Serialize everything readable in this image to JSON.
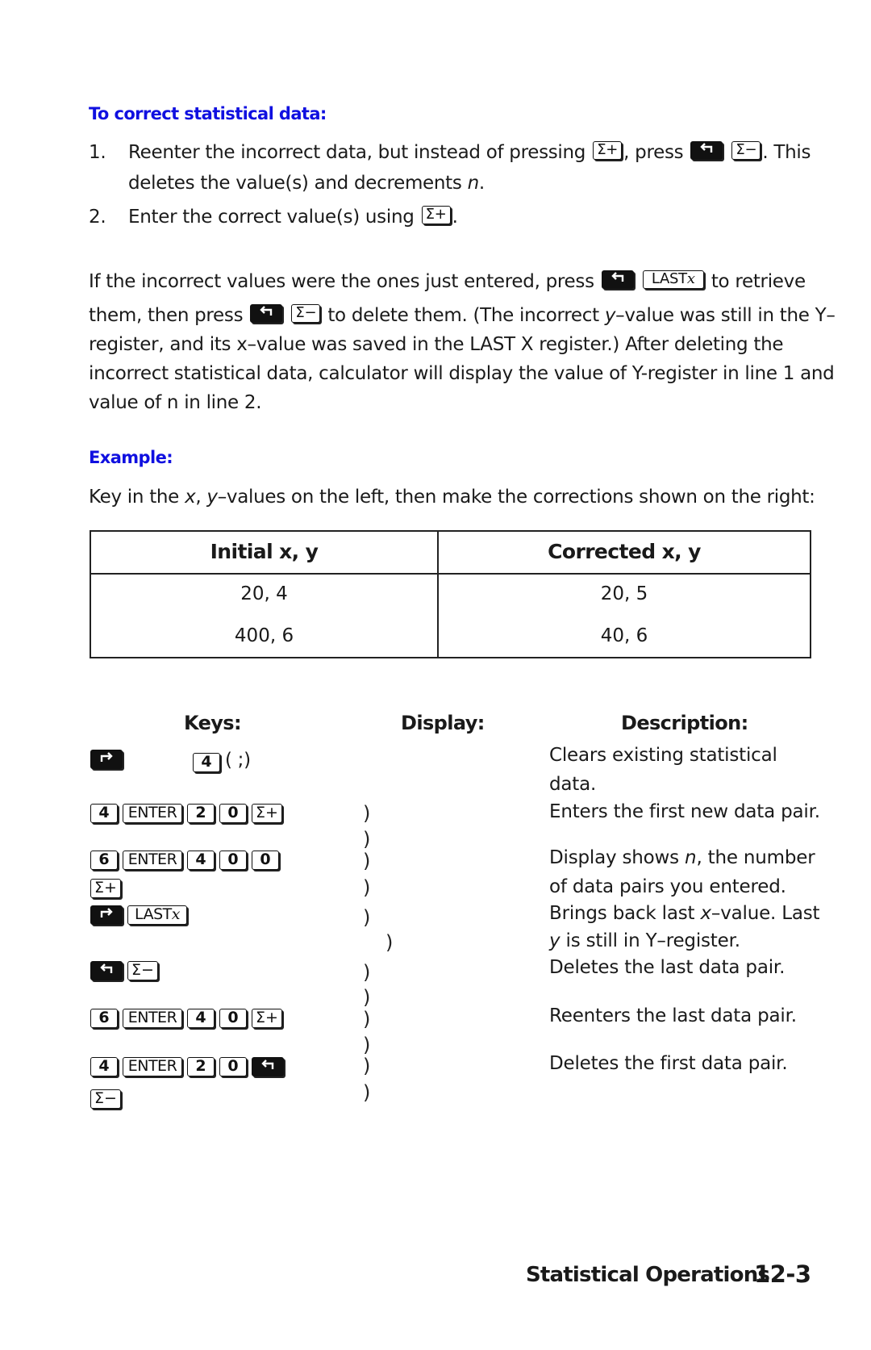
{
  "section": {
    "heading": "To correct statistical data:",
    "steps": [
      {
        "number": "1.",
        "text_before": "Reenter the incorrect data, but instead of pressing",
        "key1": "Σ+",
        "text_mid": ", press",
        "key2_icon": "left-shift-arrow",
        "key3": "Σ−",
        "text_after": ". This",
        "line2_before": "deletes the value(s) and decrements",
        "line2_var": "n",
        "line2_after": "."
      },
      {
        "number": "2.",
        "text_before": "Enter the correct value(s) using",
        "key1": "Σ+",
        "text_after": "."
      }
    ]
  },
  "paragraph": {
    "line1_before": "If the incorrect values were the ones just entered, press",
    "line1_key_shift": "left-shift-arrow",
    "line1_key": "LAST",
    "line1_key_var": "x",
    "line1_after": "to retrieve",
    "line2_before": "them, then press",
    "line2_key_shift": "left-shift-arrow",
    "line2_key": "Σ−",
    "line2_after_a": "to delete them. (The incorrect",
    "line2_var": "y",
    "line2_after_b": "–value was still in the Y–",
    "line3": "register, and its x–value was saved in the LAST X register.) After deleting the",
    "line4": "incorrect statistical data, calculator will display the value of Y-register in line 1 and",
    "line5": "value of n in line 2."
  },
  "example": {
    "heading": "Example:",
    "intro_before": "Key in the",
    "intro_var1": "x",
    "intro_mid": ",",
    "intro_var2": "y",
    "intro_after": "–values on the left, then make the corrections shown on the right:"
  },
  "table": {
    "headers": [
      "Initial x, y",
      "Corrected x, y"
    ],
    "rows": [
      [
        "20, 4",
        "20, 5"
      ],
      [
        "400, 6",
        "40, 6"
      ]
    ]
  },
  "keys_table": {
    "headers": {
      "keys": "Keys:",
      "display": "Display:",
      "description": "Description:"
    },
    "rows": [
      {
        "keys": [
          "right-shift-arrow",
          "4"
        ],
        "keys_suffix": "(   ;)",
        "display": "",
        "description_lines": [
          "Clears existing statistical",
          "data."
        ]
      },
      {
        "keys": [
          "4",
          "ENTER",
          "2",
          "0",
          "Σ+"
        ],
        "display": ")",
        "description_lines": [
          "Enters the first new data pair."
        ]
      },
      {
        "keys": [],
        "display": ")",
        "description_lines": []
      },
      {
        "keys": [
          "6",
          "ENTER",
          "4",
          "0",
          "0"
        ],
        "display": ")",
        "description_lines": [
          "Display shows n, the number"
        ]
      },
      {
        "keys": [
          "Σ+"
        ],
        "display": ")",
        "description_lines": [
          "of data pairs you entered."
        ]
      },
      {
        "keys": [
          "right-shift-arrow",
          "LASTx"
        ],
        "display": ")",
        "description_lines": [
          "Brings back last x–value. Last"
        ]
      },
      {
        "keys": [],
        "display": ")",
        "description_lines": [
          "y is still in Y–register."
        ]
      },
      {
        "keys": [
          "left-shift-arrow",
          "Σ−"
        ],
        "display": ")",
        "description_lines": [
          "Deletes the last data pair."
        ]
      },
      {
        "keys": [],
        "display": ")",
        "description_lines": []
      },
      {
        "keys": [
          "6",
          "ENTER",
          "4",
          "0",
          "Σ+"
        ],
        "display": ")",
        "description_lines": [
          "Reenters the last data pair."
        ]
      },
      {
        "keys": [],
        "display": ")",
        "description_lines": []
      },
      {
        "keys": [
          "4",
          "ENTER",
          "2",
          "0",
          "left-shift-arrow"
        ],
        "display": ")",
        "description_lines": [
          "Deletes the first data pair."
        ]
      },
      {
        "keys": [
          "Σ−"
        ],
        "display": ")",
        "description_lines": []
      }
    ],
    "desc_texts": {
      "clears_1": "Clears existing statistical",
      "clears_2": "data.",
      "enters_first": "Enters the first new data pair.",
      "display_shows_a": "Display shows",
      "display_shows_var": "n",
      "display_shows_b": ", the number",
      "of_pairs": "of data pairs you entered.",
      "brings_back_a": "Brings back last",
      "brings_back_var": "x",
      "brings_back_b": "–value. Last",
      "y_still_var": "y",
      "y_still_b": " is still in Y–register.",
      "deletes_last": "Deletes the last data pair.",
      "reenters_last": "Reenters the last data pair.",
      "deletes_first": "Deletes the first data pair."
    },
    "key_labels": {
      "four": "4",
      "two": "2",
      "zero": "0",
      "six": "6",
      "enter": "ENTER",
      "sigma_plus": "Σ+",
      "sigma_minus": "Σ−",
      "last": "LAST",
      "last_var": "x",
      "clear_suffix": "(   ;)",
      "paren": ")"
    }
  },
  "footer": {
    "chapter": "Statistical Operations",
    "page": "12-3"
  },
  "colors": {
    "heading_blue": "#1010e0",
    "text": "#1a1a1a"
  }
}
